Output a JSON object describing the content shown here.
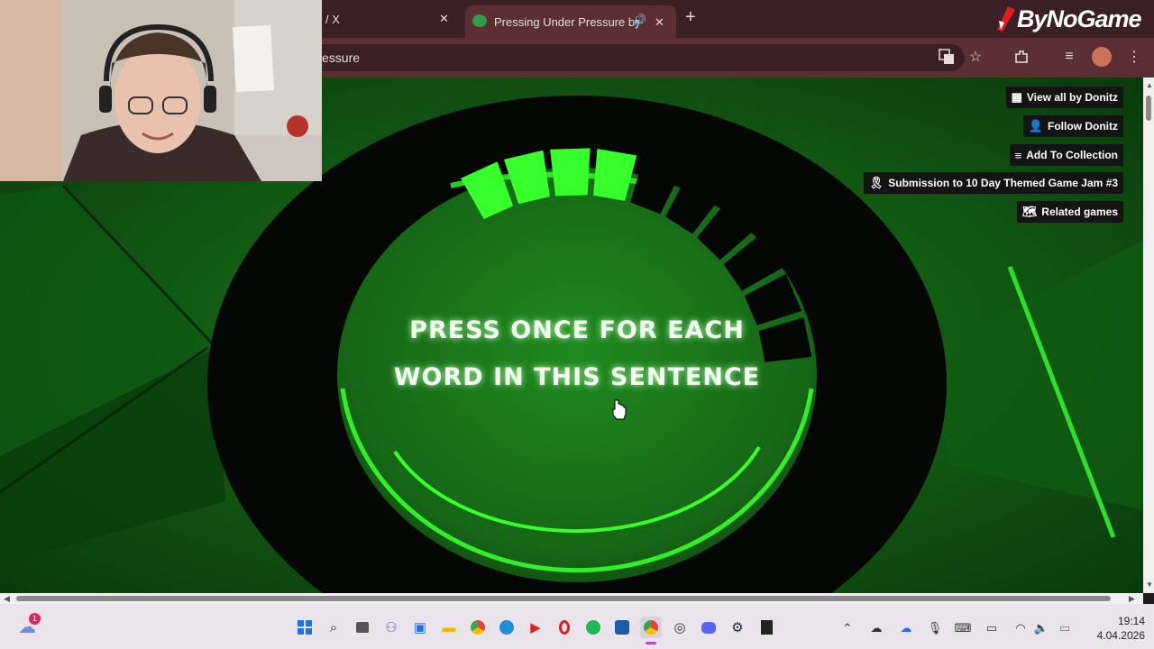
{
  "browser": {
    "tab_prev_label": "/ X",
    "tab_active_label": "Pressing Under Pressure by",
    "address_text": "essure",
    "new_tab_symbol": "+"
  },
  "watermark": {
    "text": "ByNoGame"
  },
  "game": {
    "instruction_line1": "PRESS ONCE FOR EACH",
    "instruction_line2": "WORD IN THIS SENTENCE",
    "progress_segments_lit": 4
  },
  "itch_sidebar": {
    "view_all": "View all by Donitz",
    "follow": "Follow Donitz",
    "add_collection": "Add To Collection",
    "submission": "Submission to 10 Day Themed Game Jam #3",
    "related": "Related games"
  },
  "taskbar": {
    "weather_badge": "1",
    "time": "19:14",
    "date": "4.04.2026"
  },
  "colors": {
    "neon_green": "#36ff2a",
    "tab_bar": "#3a1f24",
    "toolbar": "#5a2e33"
  }
}
